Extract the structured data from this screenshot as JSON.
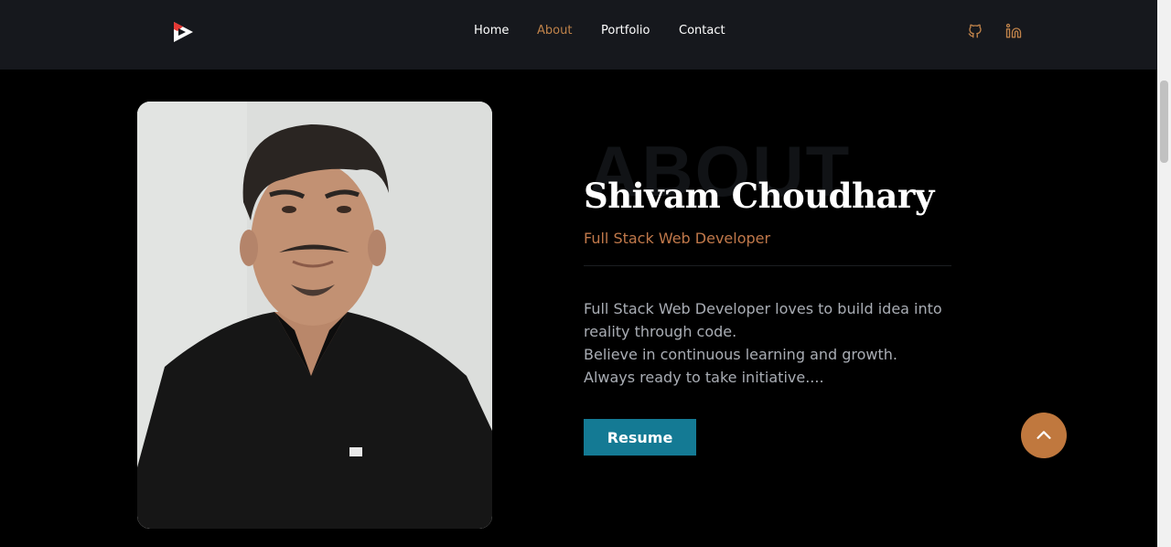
{
  "nav": {
    "items": [
      {
        "label": "Home",
        "active": false
      },
      {
        "label": "About",
        "active": true
      },
      {
        "label": "Portfolio",
        "active": false
      },
      {
        "label": "Contact",
        "active": false
      }
    ]
  },
  "social": {
    "icons": [
      "github-icon",
      "linkedin-icon"
    ],
    "color": "#c0834a"
  },
  "about": {
    "background_word": "ABOUT",
    "name": "Shivam Choudhary",
    "role": "Full Stack Web Developer",
    "bio_lines": [
      "Full Stack Web Developer loves to build idea into",
      "reality through code.",
      "Believe in continuous learning and growth.",
      "Always ready to take initiative...."
    ],
    "resume_label": "Resume"
  },
  "colors": {
    "accent": "#c0834a",
    "button": "#147a94",
    "header_bg": "#16181d",
    "page_bg": "#000000"
  }
}
